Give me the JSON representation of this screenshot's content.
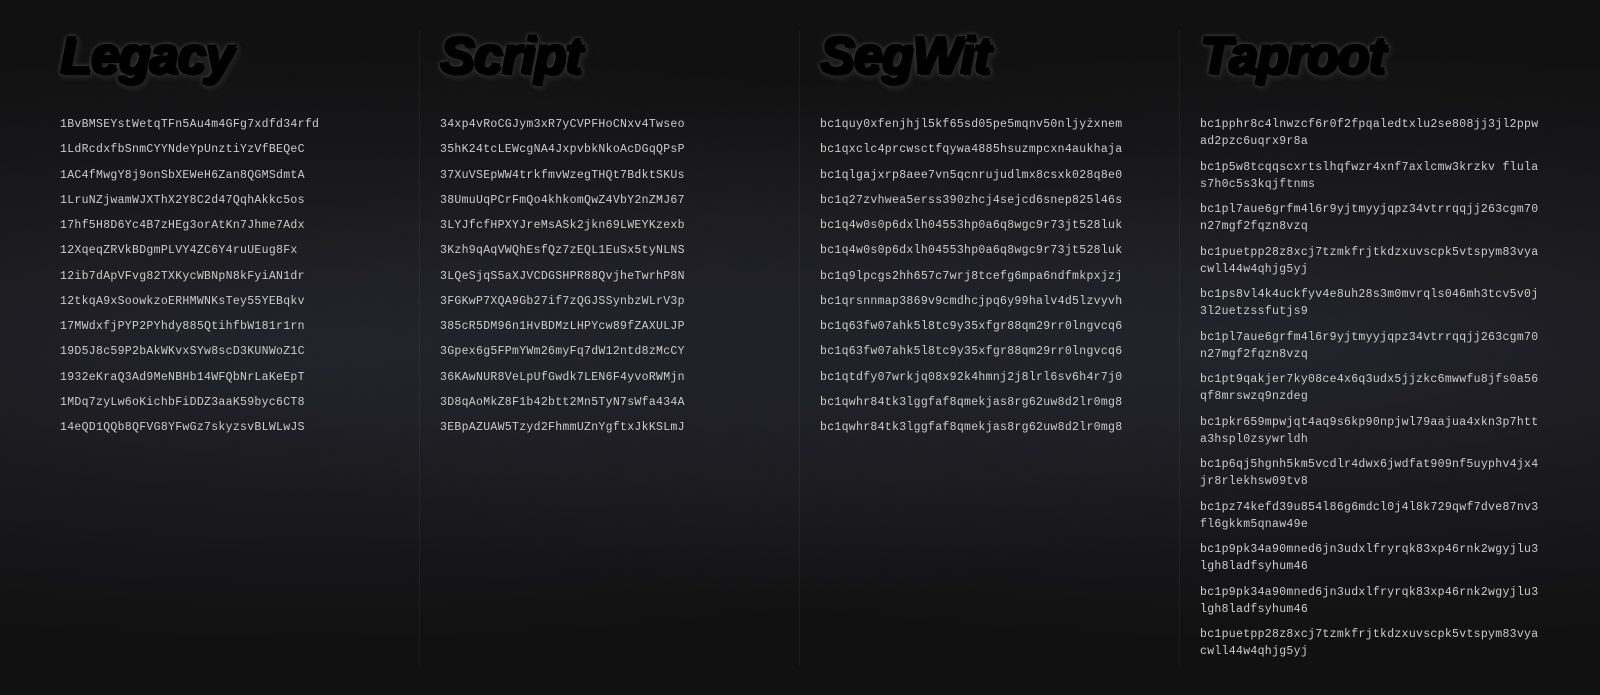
{
  "columns": [
    {
      "title": "Legacy",
      "id": "legacy",
      "addresses": [
        "1BvBMSEYstWetqTFn5Au4m4GFg7xdfd34rfd",
        "1LdRcdxfbSnmCYYNdeYpUnztiYzVfBEQeC",
        "1AC4fMwgY8j9onSbXEWeH6Zan8QGMSdmtA",
        "1LruNZjwamWJXThX2Y8C2d47QqhAkkc5os",
        "17hf5H8D6Yc4B7zHEg3orAtKn7Jhme7Adx",
        "12XqeqZRVkBDgmPLVY4ZC6Y4ruUEug8Fx",
        "12ib7dApVFvg82TXKycWBNpN8kFyiAN1dr",
        "12tkqA9xSoowkzoERHMWNKsTey55YEBqkv",
        "17MWdxfjPYP2PYhdy885QtihfbW181r1rn",
        "19D5J8c59P2bAkWKvxSYw8scD3KUNWoZ1C",
        "1932eKraQ3Ad9MeNBHb14WFQbNrLaKeEpT",
        "1MDq7zyLw6oKichbFiDDZ3aaK59byc6CT8",
        "14eQD1QQb8QFVG8YFwGz7skyzsvBLWLwJS"
      ]
    },
    {
      "title": "Script",
      "id": "script",
      "addresses": [
        "34xp4vRoCGJym3xR7yCVPFHoCNxv4Twseo",
        "35hK24tcLEWcgNA4JxpvbkNkoAcDGqQPsP",
        "37XuVSEpWW4trkfmvWzegTHQt7BdktSKUs",
        "38UmuUqPCrFmQo4khkomQwZ4VbY2nZMJ67",
        "3LYJfcfHPXYJreMsASk2jkn69LWEYKzexb",
        "3Kzh9qAqVWQhEsfQz7zEQL1EuSx5tyNLNS",
        "3LQeSjqS5aXJVCDGSHPR88QvjheTwrhP8N",
        "3FGKwP7XQA9Gb27if7zQGJSSynbzWLrV3p",
        "385cR5DM96n1HvBDMzLHPYcw89fZAXULJP",
        "3Gpex6g5FPmYWm26myFq7dW12ntd8zMcCY",
        "36KAwNUR8VeLpUfGwdk7LEN6F4yvoRWMjn",
        "3D8qAoMkZ8F1b42btt2Mn5TyN7sWfa434A",
        "3EBpAZUAW5Tzyd2FhmmUZnYgftxJkKSLmJ"
      ]
    },
    {
      "title": "SegWit",
      "id": "segwit",
      "addresses": [
        "bc1quy0xfenjhjl5kf65sd05pe5mqnv50nljyżxnem",
        "bc1qxclc4prcwsctfqywa4885hsuzmpcxn4aukhaja",
        "bc1qlgajxrp8aee7vn5qcnrujudlmx8csxk028q8e0",
        "bc1q27zvhwea5erss390zhcj4sejcd6snep825l46s",
        "bc1q4w0s0p6dxlh04553hp0a6q8wgc9r73jt528luk",
        "bc1q4w0s0p6dxlh04553hp0a6q8wgc9r73jt528luk",
        "bc1q9lpcgs2hh657c7wrj8tcefg6mpa6ndfmkpxjzj",
        "bc1qrsnnmap3869v9cmdhcjpq6y99halv4d5lzvyvh",
        "bc1q63fw07ahk5l8tc9y35xfgr88qm29rr0lngvcq6",
        "bc1q63fw07ahk5l8tc9y35xfgr88qm29rr0lngvcq6",
        "bc1qtdfy07wrkjq08x92k4hmnj2j8lrl6sv6h4r7j0",
        "bc1qwhr84tk3lggfaf8qmekjas8rg62uw8d2lr0mg8",
        "bc1qwhr84tk3lggfaf8qmekjas8rg62uw8d2lr0mg8"
      ]
    },
    {
      "title": "Taproot",
      "id": "taproot",
      "addresses": [
        "bc1pphr8c4lnwzcf6r0f2fpqaledtxlu2se808jj3jl2ppwad2pzc6uqrx9r8a",
        "bc1p5w8tcqqscxrtslhqfwzr4xnf7axlcmw3krzkv flulas7h0c5s3kqjftnms",
        "bc1pl7aue6grfm4l6r9yjtmyyjqpz34vtrrqqjj263cgm70n27mgf2fqzn8vzq",
        "bc1puetpp28z8xcj7tzmkfrjtkdzxuvscpk5vtspym83vyacwll44w4qhjg5yj",
        "bc1ps8vl4k4uckfyv4e8uh28s3m0mvrqls046mh3tcv5v0j3l2uetzssfutjs9",
        "bc1pl7aue6grfm4l6r9yjtmyyjqpz34vtrrqqjj263cgm70n27mgf2fqzn8vzq",
        "bc1pt9qakjer7ky08ce4x6q3udx5jjzkc6mwwfu8jfs0a56qf8mrswzq9nzdeg",
        "bc1pkr659mpwjqt4aq9s6kp90npjwl79aajua4xkn3p7htta3hspl0zsywrldh",
        "bc1p6qj5hgnh5km5vcdlr4dwx6jwdfat909nf5uyphv4jx4jr8rlekhsw09tv8",
        "bc1pz74kefd39u854l86g6mdcl0j4l8k729qwf7dve87nv3fl6gkkm5qnaw49e",
        "bc1p9pk34a90mned6jn3udxlfryrqk83xp46rnk2wgyjlu3lgh8ladfsyhum46",
        "bc1p9pk34a90mned6jn3udxlfryrqk83xp46rnk2wgyjlu3lgh8ladfsyhum46",
        "bc1puetpp28z8xcj7tzmkfrjtkdzxuvscpk5vtspym83vyacwll44w4qhjg5yj"
      ]
    }
  ]
}
